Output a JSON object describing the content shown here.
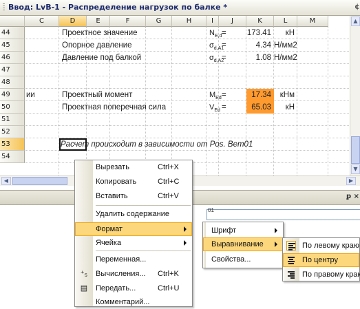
{
  "window": {
    "title": "Ввод: LvB-1 - Распределение нагрузок по балке *",
    "corner_mark": "¢"
  },
  "columns": [
    "C",
    "D",
    "E",
    "F",
    "G",
    "H",
    "I",
    "J",
    "K",
    "L",
    "M"
  ],
  "rows": [
    {
      "num": "44",
      "label": "Проектное значение",
      "sym": "N",
      "sub": "E,d",
      "eq": "=",
      "value": "173.41",
      "unit": "кН"
    },
    {
      "num": "45",
      "label": "Опорное давление",
      "sym": "σ",
      "sub": "d,A1",
      "eq": "=",
      "value": "4.34",
      "unit": "Н/мм2"
    },
    {
      "num": "46",
      "label": "Давление под балкой",
      "sym": "σ",
      "sub": "d,A2",
      "eq": "=",
      "value": "1.08",
      "unit": "Н/мм2"
    },
    {
      "num": "47"
    },
    {
      "num": "48"
    },
    {
      "num": "49",
      "prefix": "ии",
      "label": "Проектный момент",
      "sym": "M",
      "sub": "Ed",
      "eq": "=",
      "value": "17.34",
      "unit": "кНм",
      "highlight": true
    },
    {
      "num": "50",
      "label": "Проектная поперечная сила",
      "sym": "V",
      "sub": "Ed",
      "eq": "=",
      "value": "65.03",
      "unit": "кН",
      "highlight": true
    },
    {
      "num": "51"
    },
    {
      "num": "52"
    },
    {
      "num": "53",
      "note": "Расчет происходит в зависимости от Pos. Bem01",
      "selected": true
    },
    {
      "num": "54"
    }
  ],
  "panel": {
    "hint": "01",
    "pin": "ꝑ ×"
  },
  "context_menu": {
    "items": [
      {
        "label": "Вырезать",
        "shortcut": "Ctrl+X"
      },
      {
        "label": "Копировать",
        "shortcut": "Ctrl+C"
      },
      {
        "label": "Вставить",
        "shortcut": "Ctrl+V"
      },
      {
        "label": "Удалить содержание"
      },
      {
        "label": "Формат",
        "submenu": true,
        "highlighted": true
      },
      {
        "label": "Ячейка",
        "submenu": true
      },
      {
        "label": "Переменная..."
      },
      {
        "label": "Вычисления...",
        "shortcut": "Ctrl+K"
      },
      {
        "label": "Передать...",
        "shortcut": "Ctrl+U"
      },
      {
        "label": "Комментарий..."
      }
    ]
  },
  "format_menu": {
    "items": [
      {
        "label": "Шрифт",
        "submenu": true
      },
      {
        "label": "Выравнивание",
        "submenu": true,
        "highlighted": true
      },
      {
        "label": "Свойства..."
      }
    ]
  },
  "align_menu": {
    "items": [
      {
        "label": "По левому краю",
        "icon": "align-left-icon"
      },
      {
        "label": "По центру",
        "icon": "align-center-icon",
        "highlighted": true
      },
      {
        "label": "По правому краю",
        "icon": "align-right-icon"
      }
    ]
  },
  "colors": {
    "highlight_cell": "#ff9a2e",
    "menu_highlight": "#fcd77c"
  }
}
